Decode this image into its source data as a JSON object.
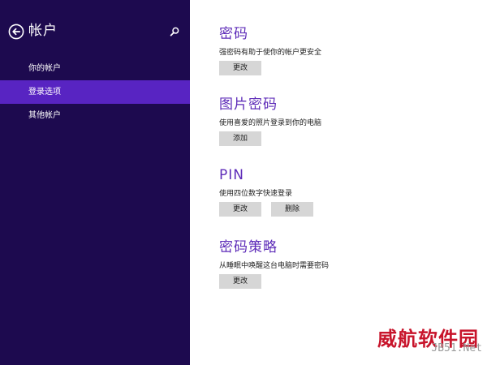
{
  "sidebar": {
    "title": "帐户",
    "back_icon": "back-arrow-circle-icon",
    "search_icon": "search-icon",
    "items": [
      {
        "label": "你的帐户",
        "active": false
      },
      {
        "label": "登录选项",
        "active": true
      },
      {
        "label": "其他帐户",
        "active": false
      }
    ],
    "colors": {
      "background": "#1d0a4f",
      "active": "#5824c2"
    }
  },
  "main": {
    "accent_color": "#5d2bb8",
    "sections": [
      {
        "title": "密码",
        "description": "强密码有助于使你的帐户更安全",
        "buttons": [
          "更改"
        ]
      },
      {
        "title": "图片密码",
        "description": "使用喜爱的照片登录到你的电脑",
        "buttons": [
          "添加"
        ]
      },
      {
        "title": "PIN",
        "description": "使用四位数字快速登录",
        "buttons": [
          "更改",
          "删除"
        ]
      },
      {
        "title": "密码策略",
        "description": "从睡眠中唤醒这台电脑时需要密码",
        "buttons": [
          "更改"
        ]
      }
    ]
  },
  "watermark": {
    "text_cn": "威航软件园",
    "text_en": "JB51.Net"
  }
}
